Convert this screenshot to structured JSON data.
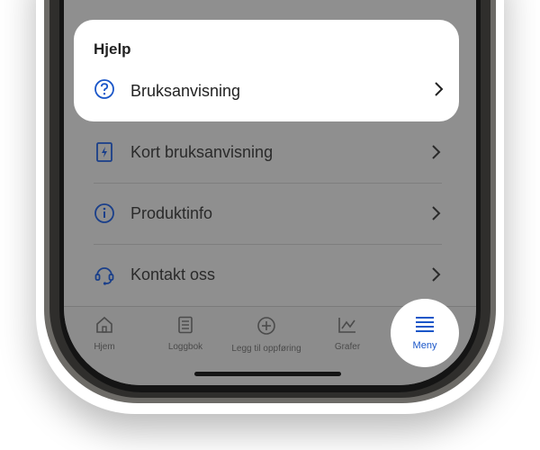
{
  "help_section": {
    "title": "Hjelp",
    "item_label": "Bruksanvisning"
  },
  "menu_items": [
    {
      "label": "Kort bruksanvisning",
      "icon": "quick-guide-icon"
    },
    {
      "label": "Produktinfo",
      "icon": "info-icon"
    },
    {
      "label": "Kontakt oss",
      "icon": "headset-icon"
    }
  ],
  "nav": {
    "items": [
      {
        "label": "Hjem",
        "icon": "home-icon"
      },
      {
        "label": "Loggbok",
        "icon": "logbook-icon"
      },
      {
        "label": "Legg til oppføring",
        "icon": "add-entry-icon"
      },
      {
        "label": "Grafer",
        "icon": "chart-icon"
      },
      {
        "label": "Meny",
        "icon": "menu-icon",
        "active": true
      }
    ]
  },
  "colors": {
    "accent": "#1a56c8",
    "overlay": "#8f8f8f"
  }
}
